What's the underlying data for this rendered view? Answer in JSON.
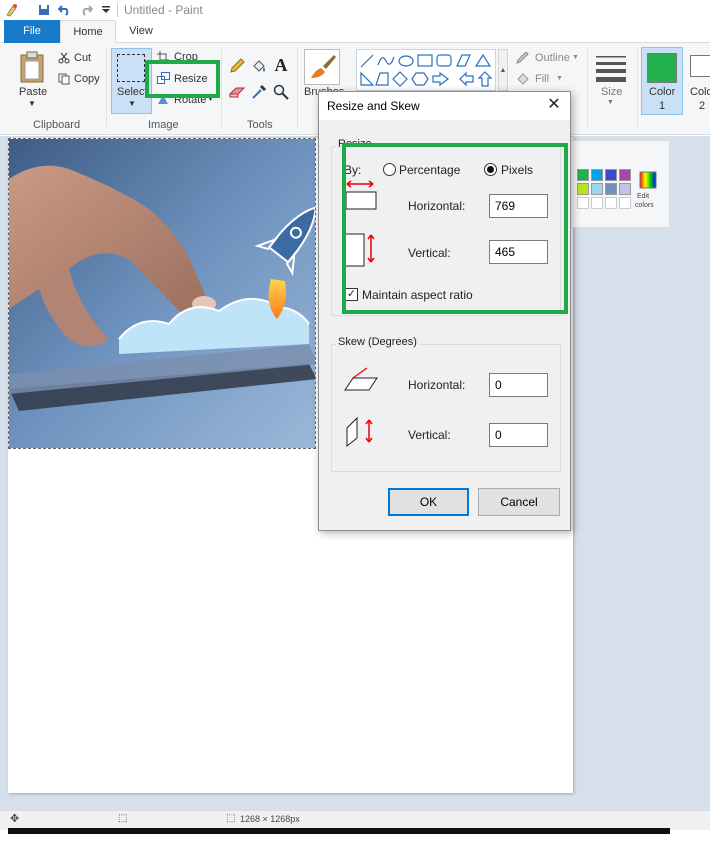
{
  "window": {
    "title": "Untitled - Paint"
  },
  "tabs": {
    "file": "File",
    "home": "Home",
    "view": "View"
  },
  "ribbon": {
    "clipboard": {
      "paste": "Paste",
      "cut": "Cut",
      "copy": "Copy",
      "group_label": "Clipboard"
    },
    "image": {
      "select": "Select",
      "crop": "Crop",
      "resize": "Resize",
      "rotate": "Rotate",
      "group_label": "Image"
    },
    "tools": {
      "group_label": "Tools"
    },
    "brushes": {
      "label": "Brushes"
    },
    "shapes": {
      "outline": "Outline",
      "fill": "Fill"
    },
    "size": {
      "label": "Size"
    },
    "color1": {
      "label": "Color",
      "sub": "1"
    },
    "color2": {
      "label": "Color",
      "sub": "2"
    },
    "edit_colors": {
      "line1": "Edit",
      "line2": "colors"
    }
  },
  "colors": {
    "accent": "#1979ca",
    "highlight": "#1eaa47",
    "color1": "#22b14c",
    "palette": [
      "#22b14c",
      "#00a2e8",
      "#3f48cc",
      "#a349a4",
      "#b5e61d",
      "#99d9ea",
      "#7092be",
      "#c8bfe7"
    ]
  },
  "dialog": {
    "title": "Resize and Skew",
    "resize": {
      "legend": "Resize",
      "by_label": "By:",
      "percentage_label": "Percentage",
      "pixels_label": "Pixels",
      "selected": "Pixels",
      "horizontal_label": "Horizontal:",
      "horizontal_value": "769",
      "vertical_label": "Vertical:",
      "vertical_value": "465",
      "maintain_label": "Maintain aspect ratio",
      "maintain_checked": true
    },
    "skew": {
      "legend": "Skew (Degrees)",
      "horizontal_label": "Horizontal:",
      "horizontal_value": "0",
      "vertical_label": "Vertical:",
      "vertical_value": "0"
    },
    "ok": "OK",
    "cancel": "Cancel"
  },
  "status": {
    "size": "1268 × 1268px"
  }
}
